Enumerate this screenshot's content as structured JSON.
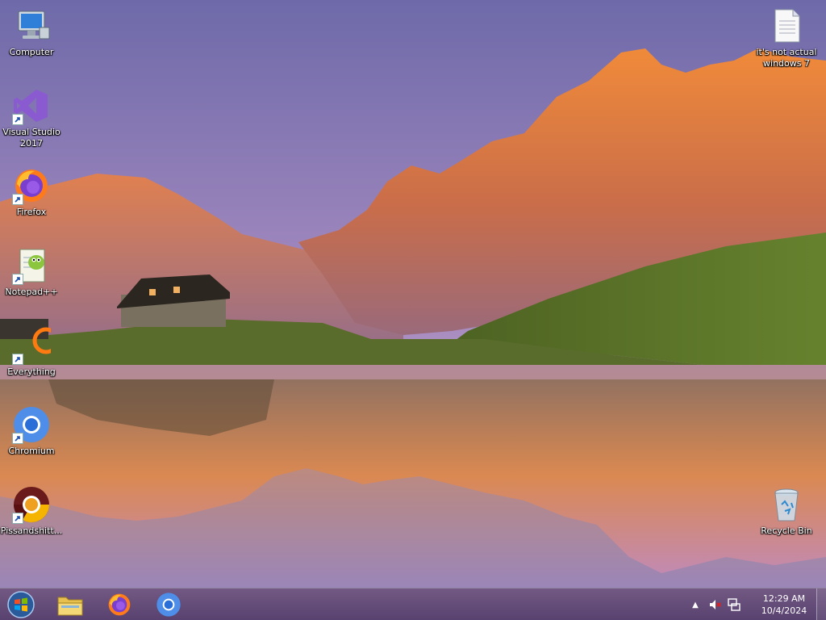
{
  "desktop": {
    "icons_left": [
      {
        "label": "Computer",
        "icon": "computer-icon"
      },
      {
        "label": "Visual Studio 2017",
        "icon": "visual-studio-icon",
        "shortcut": true
      },
      {
        "label": "Firefox",
        "icon": "firefox-icon",
        "shortcut": true
      },
      {
        "label": "Notepad++",
        "icon": "notepadplusplus-icon",
        "shortcut": true
      },
      {
        "label": "Everything",
        "icon": "everything-icon",
        "shortcut": true
      },
      {
        "label": "Chromium",
        "icon": "chromium-icon",
        "shortcut": true
      },
      {
        "label": "Pissandshitt...",
        "icon": "chrome-icon",
        "shortcut": true
      }
    ],
    "icons_right": [
      {
        "label": "it's not actual windows 7",
        "icon": "text-document-icon"
      },
      {
        "label": "Recycle Bin",
        "icon": "recycle-bin-icon"
      }
    ]
  },
  "taskbar": {
    "pinned": [
      {
        "name": "File Explorer",
        "icon": "file-explorer-icon"
      },
      {
        "name": "Firefox",
        "icon": "firefox-icon"
      },
      {
        "name": "Chromium",
        "icon": "chromium-icon"
      }
    ],
    "clock": {
      "time": "12:29 AM",
      "date": "10/4/2024"
    },
    "tray_icons": [
      "show-hidden-icons-arrow",
      "volume-muted-icon",
      "network-icon"
    ]
  },
  "colors": {
    "sky_top": "#6f6ba8",
    "sky_mid": "#b089b8",
    "mountain": "#e07a3a",
    "grass": "#5d7a2a",
    "taskbar": "#5a3c6e"
  }
}
